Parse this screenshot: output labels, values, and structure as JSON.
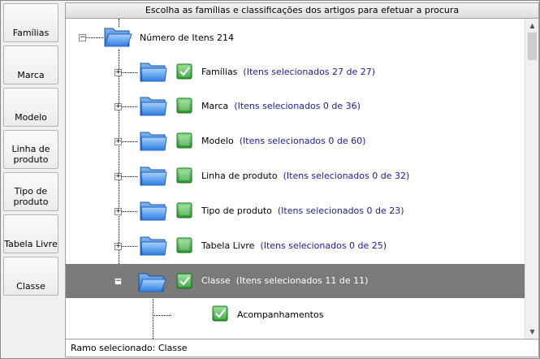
{
  "sidebar": {
    "buttons": [
      {
        "label": "Famílias"
      },
      {
        "label": "Marca"
      },
      {
        "label": "Modelo"
      },
      {
        "label": "Linha de produto"
      },
      {
        "label": "Tipo de produto"
      },
      {
        "label": "Tabela Livre"
      },
      {
        "label": "Classe"
      }
    ]
  },
  "panel": {
    "header": "Escolha as famílias e classificações dos artigos para efetuar a procura",
    "status": "Ramo selecionado: Classe"
  },
  "tree": {
    "root": {
      "label": "Número de Itens 214"
    },
    "nodes": [
      {
        "label": "Famílias",
        "count": "(Itens selecionados 27 de 27)",
        "checked": true
      },
      {
        "label": "Marca",
        "count": "(Itens selecionados 0 de 36)",
        "checked": false
      },
      {
        "label": "Modelo",
        "count": "(Itens selecionados 0 de 60)",
        "checked": false
      },
      {
        "label": "Linha de produto",
        "count": "(Itens selecionados 0 de 32)",
        "checked": false
      },
      {
        "label": "Tipo de produto",
        "count": "(Itens selecionados 0 de 23)",
        "checked": false
      },
      {
        "label": "Tabela Livre",
        "count": "(Itens selecionados 0 de 25)",
        "checked": false
      },
      {
        "label": "Classe",
        "count": "(Itens selecionados 11 de 11)",
        "checked": true,
        "selected": true
      }
    ],
    "child": {
      "label": "Acompanhamentos",
      "checked": true
    }
  },
  "colors": {
    "selected_row": "#7a7a7a",
    "count_text": "#1a1aa0",
    "check_green": "#2fa52f"
  }
}
